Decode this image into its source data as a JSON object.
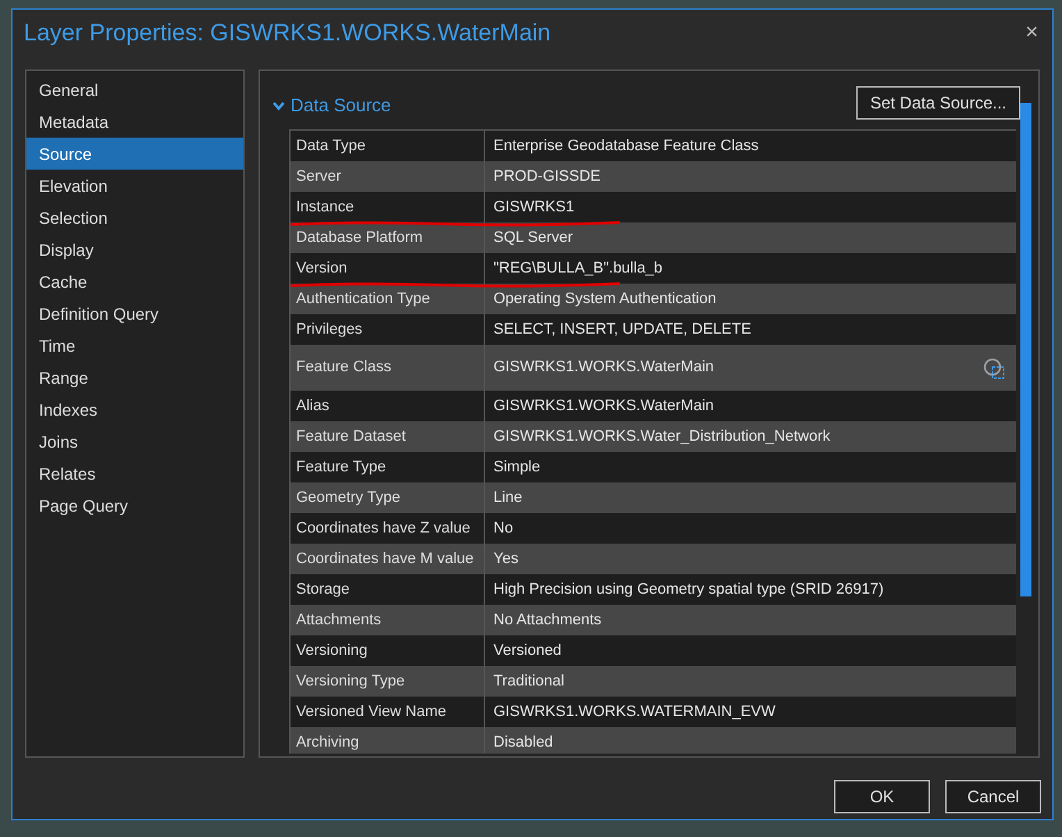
{
  "window": {
    "title": "Layer Properties: GISWRKS1.WORKS.WaterMain",
    "close": "×"
  },
  "sidebar": {
    "items": [
      {
        "label": "General",
        "selected": false
      },
      {
        "label": "Metadata",
        "selected": false
      },
      {
        "label": "Source",
        "selected": true
      },
      {
        "label": "Elevation",
        "selected": false
      },
      {
        "label": "Selection",
        "selected": false
      },
      {
        "label": "Display",
        "selected": false
      },
      {
        "label": "Cache",
        "selected": false
      },
      {
        "label": "Definition Query",
        "selected": false
      },
      {
        "label": "Time",
        "selected": false
      },
      {
        "label": "Range",
        "selected": false
      },
      {
        "label": "Indexes",
        "selected": false
      },
      {
        "label": "Joins",
        "selected": false
      },
      {
        "label": "Relates",
        "selected": false
      },
      {
        "label": "Page Query",
        "selected": false
      }
    ]
  },
  "section": {
    "title": "Data Source",
    "expanded": true,
    "button": "Set Data Source..."
  },
  "table": {
    "rows": [
      {
        "name": "Data Type",
        "value": "Enterprise Geodatabase Feature Class",
        "underlined": false
      },
      {
        "name": "Server",
        "value": "PROD-GISSDE",
        "underlined": false
      },
      {
        "name": "Instance",
        "value": "GISWRKS1",
        "underlined": true
      },
      {
        "name": "Database Platform",
        "value": "SQL Server",
        "underlined": false
      },
      {
        "name": "Version",
        "value": "\"REG\\BULLA_B\".bulla_b",
        "underlined": true
      },
      {
        "name": "Authentication Type",
        "value": "Operating System Authentication",
        "underlined": false
      },
      {
        "name": "Privileges",
        "value": "SELECT, INSERT, UPDATE, DELETE",
        "underlined": false
      },
      {
        "name": "Feature Class",
        "value": "GISWRKS1.WORKS.WaterMain",
        "underlined": false,
        "kind": "action"
      },
      {
        "name": "Alias",
        "value": "GISWRKS1.WORKS.WaterMain",
        "underlined": false
      },
      {
        "name": "Feature Dataset",
        "value": "GISWRKS1.WORKS.Water_Distribution_Network",
        "underlined": false
      },
      {
        "name": "Feature Type",
        "value": "Simple",
        "underlined": false
      },
      {
        "name": "Geometry Type",
        "value": "Line",
        "underlined": false
      },
      {
        "name": "Coordinates have Z value",
        "value": "No",
        "underlined": false
      },
      {
        "name": "Coordinates have M value",
        "value": "Yes",
        "underlined": false
      },
      {
        "name": "Storage",
        "value": "High Precision using Geometry spatial type (SRID 26917)",
        "underlined": false
      },
      {
        "name": "Attachments",
        "value": "No Attachments",
        "underlined": false
      },
      {
        "name": "Versioning",
        "value": "Versioned",
        "underlined": false
      },
      {
        "name": "Versioning Type",
        "value": "Traditional",
        "underlined": false
      },
      {
        "name": "Versioned View Name",
        "value": "GISWRKS1.WORKS.WATERMAIN_EVW",
        "underlined": false
      },
      {
        "name": "Archiving",
        "value": "Disabled",
        "underlined": false
      }
    ]
  },
  "buttons": [
    "OK",
    "Cancel"
  ]
}
